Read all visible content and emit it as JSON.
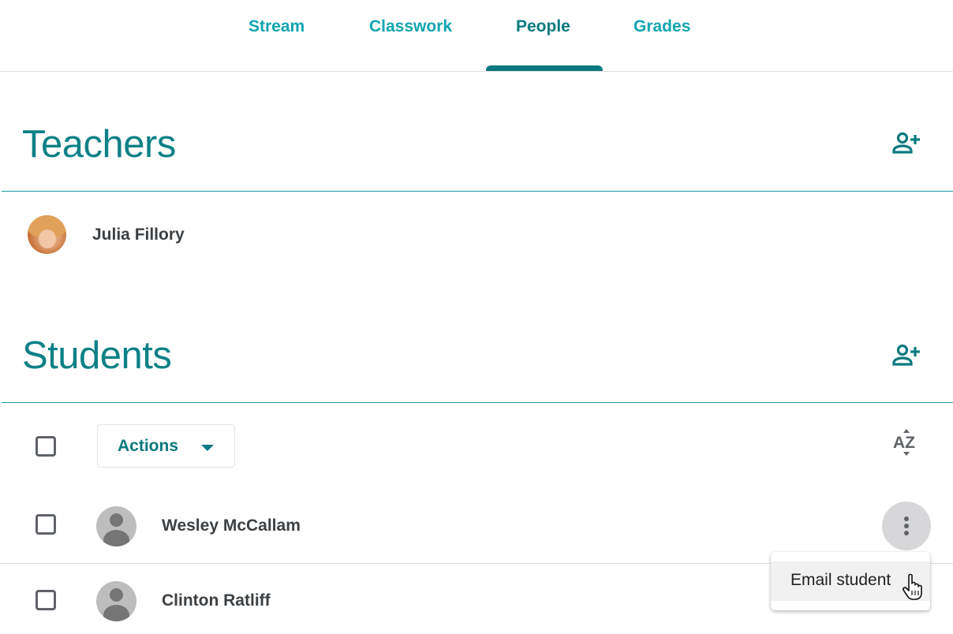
{
  "tabs": [
    {
      "label": "Stream",
      "active": false
    },
    {
      "label": "Classwork",
      "active": false
    },
    {
      "label": "People",
      "active": true
    },
    {
      "label": "Grades",
      "active": false
    }
  ],
  "teachers": {
    "title": "Teachers",
    "add_icon": "person-add-icon",
    "list": [
      {
        "name": "Julia Fillory",
        "avatar": "photo"
      }
    ]
  },
  "students": {
    "title": "Students",
    "add_icon": "person-add-icon",
    "toolbar": {
      "actions_label": "Actions",
      "sort_icon": "sort-az-icon"
    },
    "list": [
      {
        "name": "Wesley McCallam",
        "avatar": "default-avatar",
        "selected": false
      },
      {
        "name": "Clinton Ratliff",
        "avatar": "default-avatar",
        "selected": false
      }
    ],
    "row_menu": {
      "open_for": "Wesley McCallam",
      "items": [
        {
          "label": "Email student"
        }
      ]
    }
  },
  "colors": {
    "accent": "#0b7a80",
    "tab_inactive": "#12a5b0",
    "heading": "#0b8186"
  }
}
